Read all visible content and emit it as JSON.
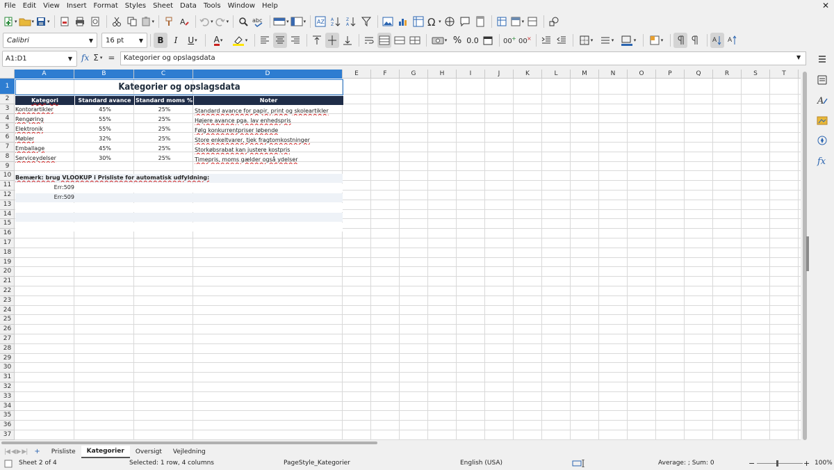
{
  "menubar": {
    "items": [
      "File",
      "Edit",
      "View",
      "Insert",
      "Format",
      "Styles",
      "Sheet",
      "Data",
      "Tools",
      "Window",
      "Help"
    ]
  },
  "toolbar2": {
    "font_name": "Calibri",
    "font_size": "16 pt",
    "bold_label": "B",
    "italic_label": "I",
    "underline_label": "U",
    "font_color_label": "A",
    "percent_label": "%",
    "decimal_label": "0.0"
  },
  "formulabar": {
    "name_box": "A1:D1",
    "formula": "Kategorier og opslagsdata"
  },
  "sheet": {
    "columns": [
      "A",
      "B",
      "C",
      "D",
      "E",
      "F",
      "G",
      "H",
      "I",
      "J",
      "K",
      "L",
      "M",
      "N",
      "O",
      "P",
      "Q",
      "R",
      "S",
      "T"
    ],
    "rows": [
      "1",
      "2",
      "3",
      "4",
      "5",
      "6",
      "7",
      "8",
      "9",
      "10",
      "11",
      "12",
      "13",
      "14",
      "15",
      "16",
      "17",
      "18",
      "19",
      "20",
      "21",
      "22",
      "23",
      "24",
      "25",
      "26",
      "27",
      "28",
      "29",
      "30",
      "31",
      "32",
      "33",
      "34",
      "35",
      "36",
      "37"
    ],
    "title": "Kategorier og opslagsdata",
    "headers": [
      "Kategori",
      "Standard avance %",
      "Standard moms %",
      "Noter"
    ],
    "data": [
      [
        "Kontorartikler",
        "45%",
        "25%",
        "Standard avance for papir, print og skoleartikler"
      ],
      [
        "Rengøring",
        "55%",
        "25%",
        "Højere avance pga. lav enhedspris"
      ],
      [
        "Elektronik",
        "55%",
        "25%",
        "Følg konkurrentpriser løbende"
      ],
      [
        "Møbler",
        "32%",
        "25%",
        "Store enkeltvarer, tjek fragtomkostninger"
      ],
      [
        "Emballage",
        "45%",
        "25%",
        "Storkøbsrabat kan justere kostpris"
      ],
      [
        "Serviceydelser",
        "30%",
        "25%",
        "Timepris, moms gælder også ydelser"
      ]
    ],
    "note": "Bemærk: brug VLOOKUP i Prisliste for automatisk udfyldning:",
    "errors": [
      "Err:509",
      "Err:509"
    ]
  },
  "tabs": {
    "items": [
      "Prisliste",
      "Kategorier",
      "Oversigt",
      "Vejledning"
    ],
    "active": "Kategorier"
  },
  "statusbar": {
    "sheet_info": "Sheet 2 of 4",
    "selection": "Selected: 1 row, 4 columns",
    "page_style": "PageStyle_Kategorier",
    "language": "English (USA)",
    "summary": "Average: ; Sum: 0",
    "zoom": "100%"
  },
  "colors": {
    "selection": "#2e7dd1",
    "header_fill": "#1f2d48",
    "row_alt": "#eef2f7"
  }
}
